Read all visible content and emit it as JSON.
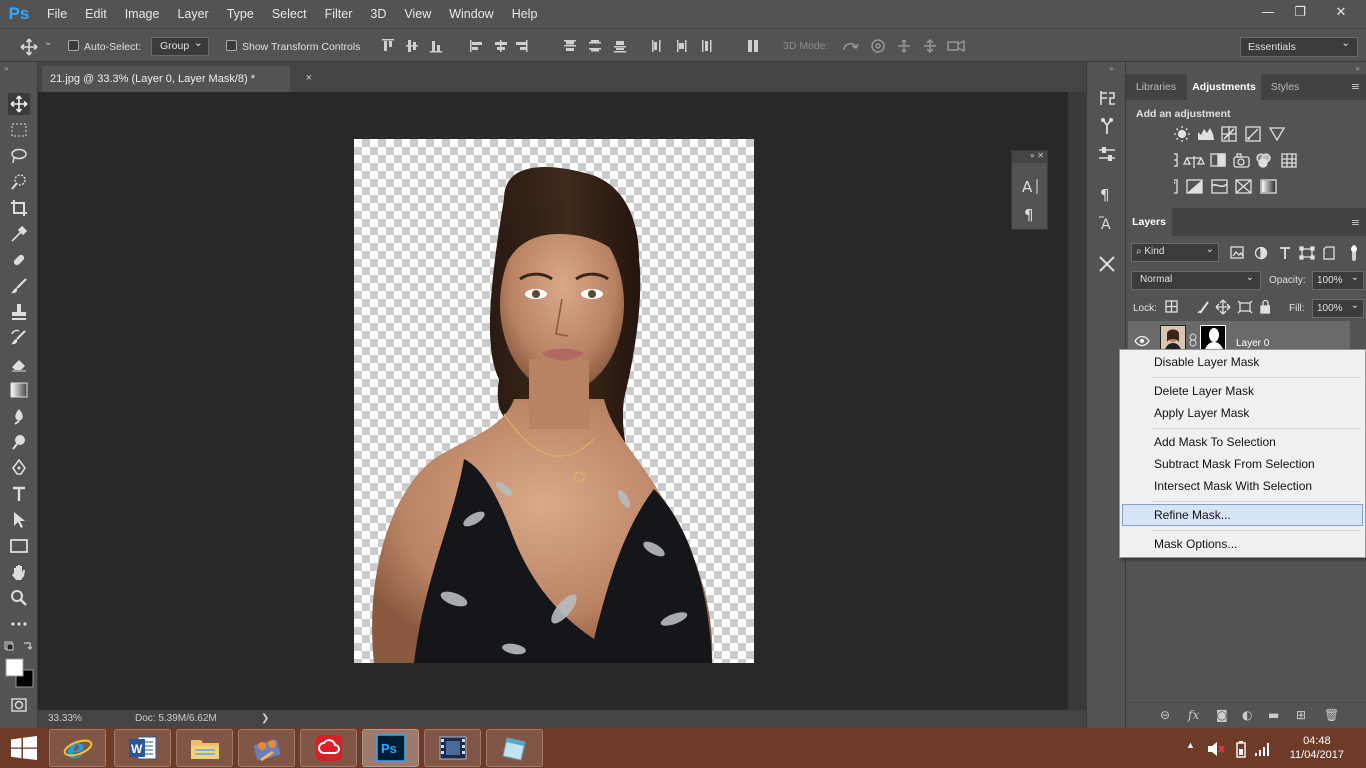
{
  "app": {
    "logo": "Ps"
  },
  "menu": [
    "File",
    "Edit",
    "Image",
    "Layer",
    "Type",
    "Select",
    "Filter",
    "3D",
    "View",
    "Window",
    "Help"
  ],
  "window_controls": {
    "minimize": "—",
    "restore": "❐",
    "close": "✕"
  },
  "options_bar": {
    "auto_select_label": "Auto-Select:",
    "auto_select_value": "Group",
    "show_transform_label": "Show Transform Controls",
    "mode_3d_label": "3D Mode:",
    "workspace": "Essentials"
  },
  "document": {
    "tab_title": "21.jpg @ 33.3% (Layer 0, Layer Mask/8) *",
    "tab_close": "×",
    "zoom": "33.33%",
    "doc_info": "Doc: 5.39M/6.62M",
    "status_arrow": "❯"
  },
  "panels": {
    "top_tabs": [
      "Libraries",
      "Adjustments",
      "Styles"
    ],
    "active_top_tab": "Adjustments",
    "adjustments_title": "Add an adjustment",
    "layers_tab": "Layers",
    "kind_filter": "Kind",
    "blend_mode": "Normal",
    "opacity_label": "Opacity:",
    "opacity_value": "100%",
    "lock_label": "Lock:",
    "fill_label": "Fill:",
    "fill_value": "100%",
    "layer_name": "Layer 0"
  },
  "context_menu": {
    "items": [
      "Disable Layer Mask",
      "Delete Layer Mask",
      "Apply Layer Mask",
      "Add Mask To Selection",
      "Subtract Mask From Selection",
      "Intersect Mask With Selection",
      "Refine Mask...",
      "Mask Options..."
    ],
    "highlighted": "Refine Mask..."
  },
  "taskbar": {
    "apps": [
      "internet-explorer",
      "word",
      "file-explorer",
      "media-player",
      "creative-cloud",
      "photoshop",
      "movie-maker",
      "notepad"
    ],
    "active_app": "photoshop",
    "time": "04:48",
    "date": "11/04/2017"
  },
  "colors": {
    "ps_blue": "#31a8ff",
    "taskbar": "#6e3b28",
    "panel": "#535353",
    "canvas_bg": "#282828"
  }
}
